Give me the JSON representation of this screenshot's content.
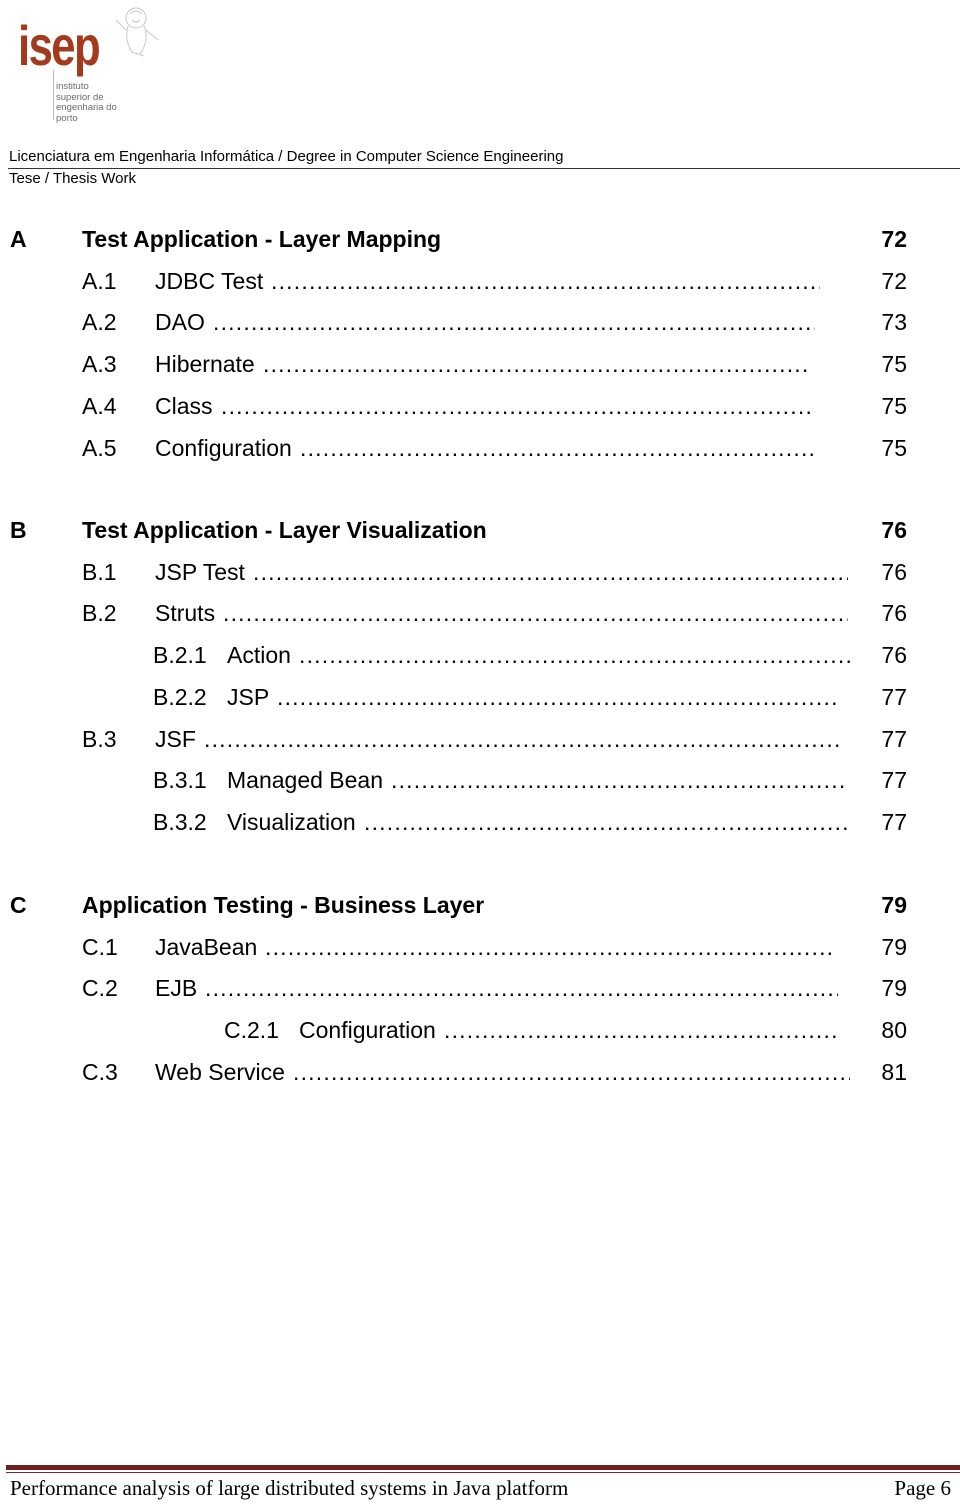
{
  "logo": {
    "wordmark": "isep",
    "subtitle_lines": [
      "instituto",
      "superior de",
      "engenharia do",
      "porto"
    ],
    "brand_color": "#a33a1c"
  },
  "header": {
    "line1": "Licenciatura em Engenharia Informática / Degree in Computer Science Engineering",
    "line2": "Tese / Thesis Work"
  },
  "toc": {
    "chapters": [
      {
        "letter": "A",
        "title": "Test Application - Layer Mapping",
        "page": "72",
        "entries": [
          {
            "num": "A.1",
            "title": "JDBC Test",
            "page": "72",
            "level": 2
          },
          {
            "num": "A.2",
            "title": "DAO",
            "page": "73",
            "level": 2
          },
          {
            "num": "A.3",
            "title": "Hibernate",
            "page": "75",
            "level": 2
          },
          {
            "num": "A.4",
            "title": "Class",
            "page": "75",
            "level": 2
          },
          {
            "num": "A.5",
            "title": "Configuration",
            "page": "75",
            "level": 2
          }
        ]
      },
      {
        "letter": "B",
        "title": "Test Application - Layer Visualization",
        "page": "76",
        "entries": [
          {
            "num": "B.1",
            "title": "JSP Test",
            "page": "76",
            "level": 2
          },
          {
            "num": "B.2",
            "title": "Struts",
            "page": "76",
            "level": 2
          },
          {
            "num": "B.2.1",
            "title": "Action",
            "page": "76",
            "level": 3
          },
          {
            "num": "B.2.2",
            "title": "JSP",
            "page": "77",
            "level": 3
          },
          {
            "num": "B.3",
            "title": "JSF",
            "page": "77",
            "level": 2
          },
          {
            "num": "B.3.1",
            "title": "Managed Bean",
            "page": "77",
            "level": 3
          },
          {
            "num": "B.3.2",
            "title": "Visualization",
            "page": "77",
            "level": 3
          }
        ]
      },
      {
        "letter": "C",
        "title": "Application Testing - Business Layer",
        "page": "79",
        "entries": [
          {
            "num": "C.1",
            "title": "JavaBean",
            "page": "79",
            "level": 2
          },
          {
            "num": "C.2",
            "title": "EJB",
            "page": "79",
            "level": 2
          },
          {
            "num": "C.2.1",
            "title": "Configuration",
            "page": "80",
            "level": 4
          },
          {
            "num": "C.3",
            "title": "Web Service",
            "page": "81",
            "level": 2
          }
        ]
      }
    ]
  },
  "footer": {
    "title": "Performance analysis of large distributed systems in Java platform",
    "page_label": "Page 6",
    "rule_color": "#6e2020"
  }
}
